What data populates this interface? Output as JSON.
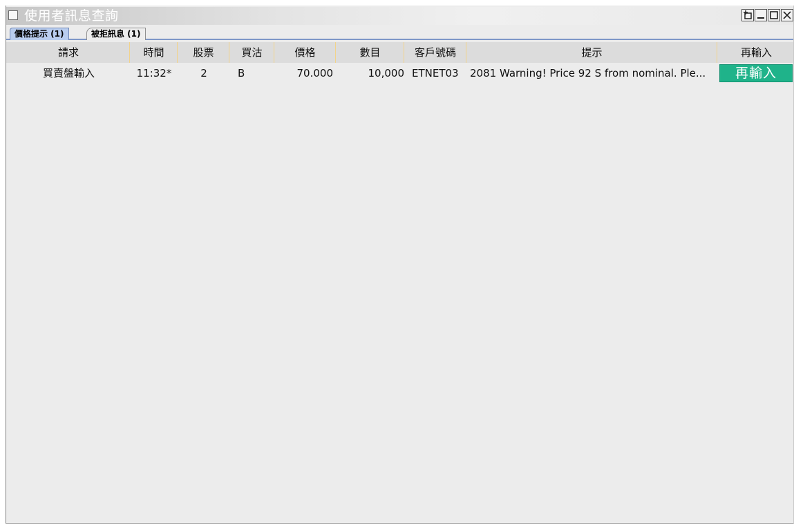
{
  "window": {
    "title": "使用者訊息查詢"
  },
  "tabs": [
    {
      "label": "價格提示 (1)",
      "active": true
    },
    {
      "label": "被拒訊息 (1)",
      "active": false
    }
  ],
  "table": {
    "headers": {
      "request": "請求",
      "time": "時間",
      "stock": "股票",
      "side": "買沽",
      "price": "價格",
      "quantity": "數目",
      "customer": "客戶號碼",
      "message": "提示",
      "reenter": "再輸入"
    },
    "rows": [
      {
        "request": "買賣盤輸入",
        "time": "11:32*",
        "stock": "2",
        "side": "B",
        "price": "70.000",
        "quantity": "10,000",
        "customer": "ETNET03",
        "message": "2081 Warning! Price  92 S from nominal. Ple...",
        "reenter_button": "再輸入"
      }
    ]
  },
  "colors": {
    "active_tab": "#b9cdef",
    "reenter_button": "#1fb38a",
    "header_separator": "#f2d38a",
    "window_background": "#ececec"
  },
  "icons": [
    "window-checkbox-icon",
    "restore-icon",
    "minimize-icon",
    "maximize-icon",
    "close-icon"
  ]
}
